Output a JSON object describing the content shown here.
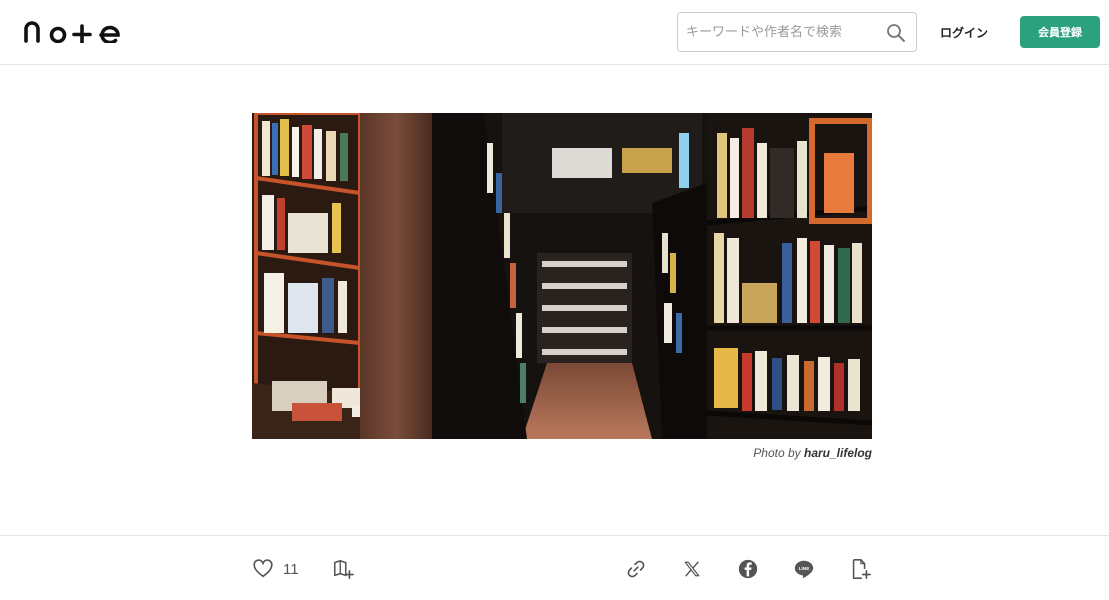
{
  "header": {
    "logo_text": "note",
    "search_placeholder": "キーワードや作者名で検索",
    "login_label": "ログイン",
    "signup_label": "会員登録"
  },
  "article": {
    "photo_credit_prefix": "Photo by",
    "photo_credit_author": "haru_lifelog"
  },
  "actions": {
    "like_count": "11",
    "share_icons": [
      "link-icon",
      "x-icon",
      "facebook-icon",
      "line-icon",
      "add-note-icon"
    ]
  },
  "colors": {
    "accent": "#2ba17e",
    "border": "#e6e6e6",
    "icon": "#555555"
  }
}
